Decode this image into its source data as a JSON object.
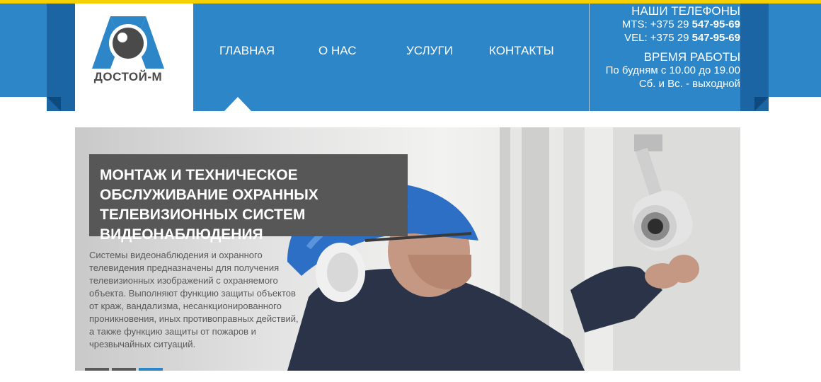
{
  "brand": {
    "name": "ДОСТОЙ-М",
    "colors": {
      "primary": "#2d86c8",
      "dark": "#1b65a5",
      "accent": "#f5d100"
    }
  },
  "nav": {
    "items": [
      {
        "label": "ГЛАВНАЯ",
        "active": true
      },
      {
        "label": "О НАС"
      },
      {
        "label": "УСЛУГИ"
      },
      {
        "label": "КОНТАКТЫ"
      }
    ]
  },
  "contacts": {
    "phones_title": "НАШИ ТЕЛЕФОНЫ",
    "mts_prefix": "MTS: +375 29 ",
    "mts_number": "547-95-69",
    "vel_prefix": "VEL: +375 29 ",
    "vel_number": "547-95-69",
    "hours_title": "ВРЕМЯ РАБОТЫ",
    "weekdays": "По будням с 10.00 до 19.00",
    "weekend": "Сб. и Вс. - выходной"
  },
  "hero": {
    "title": "МОНТАЖ И ТЕХНИЧЕСКОЕ ОБСЛУЖИВАНИЕ ОХРАННЫХ ТЕЛЕВИЗИОННЫХ СИСТЕМ ВИДЕОНАБЛЮДЕНИЯ",
    "text": "Системы видеонаблюдения и охранного телевидения предназначены для получения телевизионных изображений с охраняемого объекта. Выполняют функцию защиты объектов от краж, вандализма, несанкционированного проникновения, иных противоправных действий, а также функцию защиты от пожаров и чрезвычайных ситуаций.",
    "slides": {
      "count": 3,
      "active": 3
    }
  }
}
